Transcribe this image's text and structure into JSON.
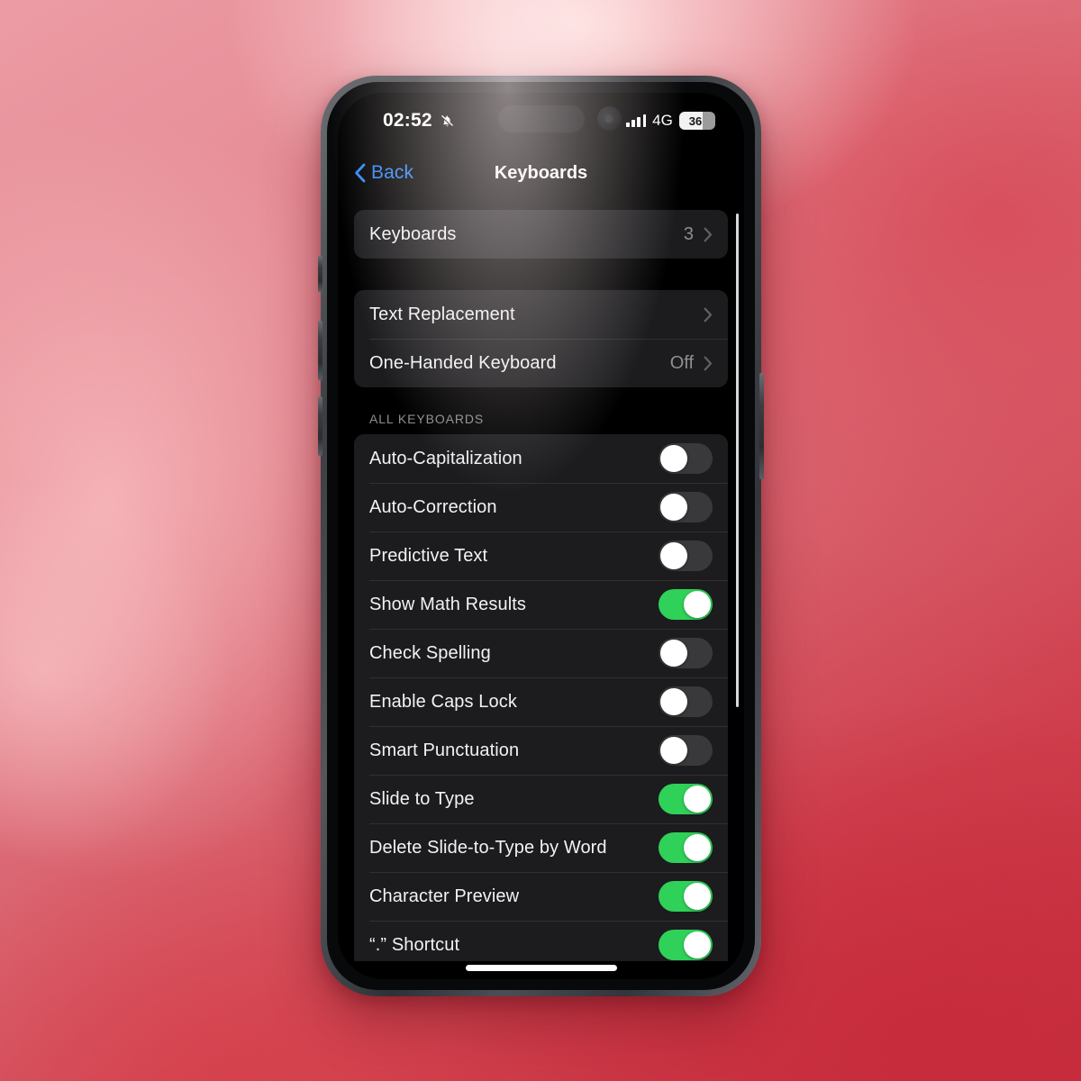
{
  "status_bar": {
    "time": "02:52",
    "mute_icon": "bell-slash-icon",
    "network": "4G",
    "battery_level": "36",
    "signal_bars": 4
  },
  "nav": {
    "back_label": "Back",
    "back_icon": "chevron-left-icon",
    "title": "Keyboards"
  },
  "groups": [
    {
      "rows": [
        {
          "label": "Keyboards",
          "value": "3",
          "type": "disclosure"
        }
      ]
    },
    {
      "rows": [
        {
          "label": "Text Replacement",
          "value": "",
          "type": "disclosure"
        },
        {
          "label": "One-Handed Keyboard",
          "value": "Off",
          "type": "disclosure"
        }
      ]
    }
  ],
  "all_keyboards": {
    "header": "ALL KEYBOARDS",
    "rows": [
      {
        "label": "Auto-Capitalization",
        "on": false
      },
      {
        "label": "Auto-Correction",
        "on": false
      },
      {
        "label": "Predictive Text",
        "on": false
      },
      {
        "label": "Show Math Results",
        "on": true
      },
      {
        "label": "Check Spelling",
        "on": false
      },
      {
        "label": "Enable Caps Lock",
        "on": false
      },
      {
        "label": "Smart Punctuation",
        "on": false
      },
      {
        "label": "Slide to Type",
        "on": true
      },
      {
        "label": "Delete Slide-to-Type by Word",
        "on": true
      },
      {
        "label": "Character Preview",
        "on": true
      },
      {
        "label": "“.” Shortcut",
        "on": true
      }
    ]
  },
  "colors": {
    "accent_blue": "#2f87f8",
    "toggle_on_green": "#2fd159",
    "toggle_off_gray": "#39393c",
    "card_bg": "#1c1c1e",
    "screen_bg": "#000000",
    "secondary_text": "#8d8d93"
  }
}
